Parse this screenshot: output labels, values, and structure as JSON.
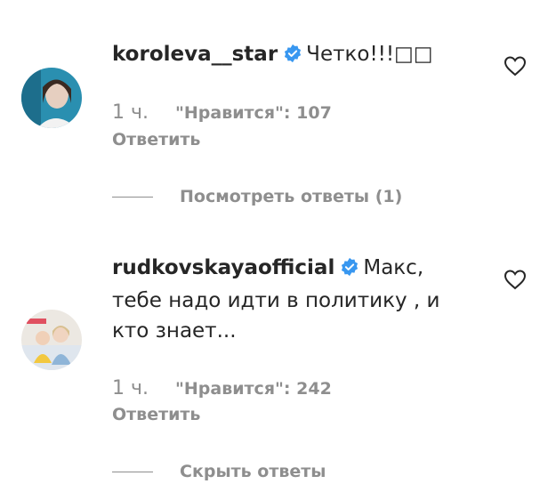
{
  "comments": [
    {
      "avatar": "user-avatar-photo",
      "username": "koroleva__star",
      "verified_icon": "verified-badge-icon",
      "text": "Четко!!!□□",
      "time": "1 ч.",
      "likes": "\"Нравится\": 107",
      "reply_label": "Ответить",
      "replies_toggle_label": "Посмотреть ответы (1)",
      "like_icon": "heart-outline-icon"
    },
    {
      "avatar": "user-avatar-photo",
      "username": "rudkovskayaofficial",
      "verified_icon": "verified-badge-icon",
      "text_lines": [
        "Макс,",
        "тебе надо идти в политику , и",
        "кто знает..."
      ],
      "time": "1 ч.",
      "likes": "\"Нравится\": 242",
      "reply_label": "Ответить",
      "replies_toggle_label": "Скрыть ответы",
      "like_icon": "heart-outline-icon"
    }
  ],
  "colors": {
    "text": "#262626",
    "secondary": "#8e8e8e",
    "verified": "#3897f0"
  }
}
